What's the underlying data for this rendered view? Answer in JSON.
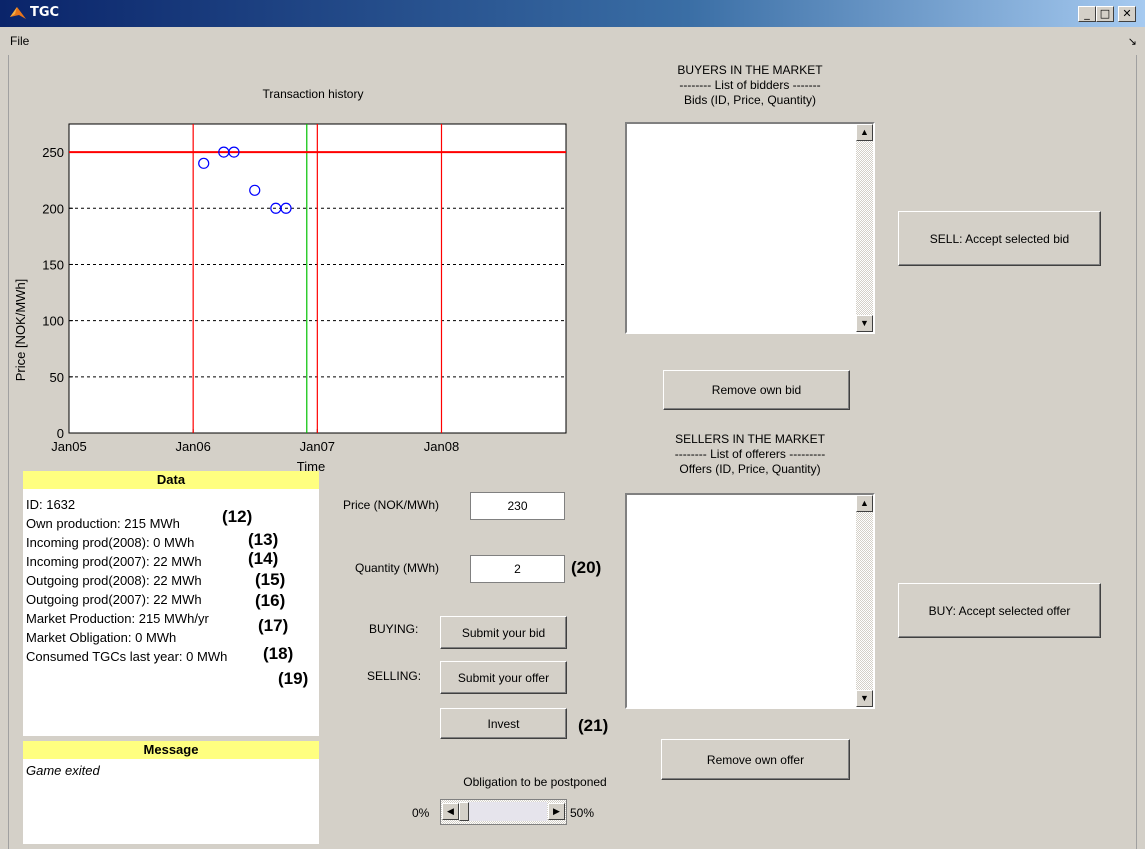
{
  "window": {
    "title": "TGC"
  },
  "menu": {
    "file": "File",
    "undock": "↘"
  },
  "chart": {
    "title": "Transaction history",
    "xlabel": "Time",
    "ylabel": "Price [NOK/MWh]"
  },
  "chart_data": {
    "type": "scatter",
    "title": "Transaction history",
    "xlabel": "Time",
    "ylabel": "Price [NOK/MWh]",
    "x_ticks": [
      "Jan05",
      "Jan06",
      "Jan07",
      "Jan08"
    ],
    "y_ticks": [
      0,
      50,
      100,
      150,
      200,
      250
    ],
    "xlim": [
      "2005-01-01",
      "2009-01-01"
    ],
    "ylim": [
      0,
      275
    ],
    "grid": "horizontal dashed",
    "points": [
      {
        "x": "2006-02-01",
        "y": 240
      },
      {
        "x": "2006-04-01",
        "y": 250
      },
      {
        "x": "2006-05-01",
        "y": 250
      },
      {
        "x": "2006-07-01",
        "y": 216
      },
      {
        "x": "2006-09-01",
        "y": 200
      },
      {
        "x": "2006-10-01",
        "y": 200
      }
    ],
    "hlines": [
      {
        "y": 250,
        "color": "#ff0000"
      }
    ],
    "vlines_red": [
      "2006-01-01",
      "2007-01-01",
      "2008-01-01"
    ],
    "vline_green": "2006-12-01",
    "colors": {
      "points": "#0000ff",
      "red": "#ff0000",
      "green": "#00c000"
    }
  },
  "buyers": {
    "title": "BUYERS IN THE MARKET",
    "subtitle": "-------- List of bidders -------",
    "caption": "Bids (ID, Price, Quantity)",
    "sell_button": "SELL: Accept selected bid",
    "remove_button": "Remove own bid"
  },
  "sellers": {
    "title": "SELLERS IN THE MARKET",
    "subtitle": "-------- List of offerers ---------",
    "caption": "Offers (ID, Price, Quantity)",
    "buy_button": "BUY: Accept selected offer",
    "remove_button": "Remove own offer"
  },
  "form": {
    "price_label": "Price (NOK/MWh)",
    "price_value": "230",
    "quantity_label": "Quantity (MWh)",
    "quantity_value": "2",
    "buying_label": "BUYING:",
    "selling_label": "SELLING:",
    "submit_bid": "Submit your bid",
    "submit_offer": "Submit your offer",
    "invest": "Invest",
    "postpone_label": "Obligation to be postponed",
    "slider_min": "0%",
    "slider_max": "50%",
    "slider_value_percent": 0
  },
  "data_panel": {
    "heading": "Data",
    "lines": [
      "ID: 1632",
      "Own production: 215 MWh",
      "Incoming prod(2008): 0 MWh",
      "Incoming prod(2007): 22 MWh",
      "Outgoing prod(2008): 22 MWh",
      "Outgoing prod(2007): 22 MWh",
      "Market Production: 215 MWh/yr",
      "Market Obligation: 0 MWh",
      "Consumed TGCs last year: 0 MWh"
    ]
  },
  "message_panel": {
    "heading": "Message",
    "text": "Game exited"
  },
  "annotations": [
    "(12)",
    "(13)",
    "(14)",
    "(15)",
    "(16)",
    "(17)",
    "(18)",
    "(19)",
    "(20)",
    "(21)"
  ]
}
